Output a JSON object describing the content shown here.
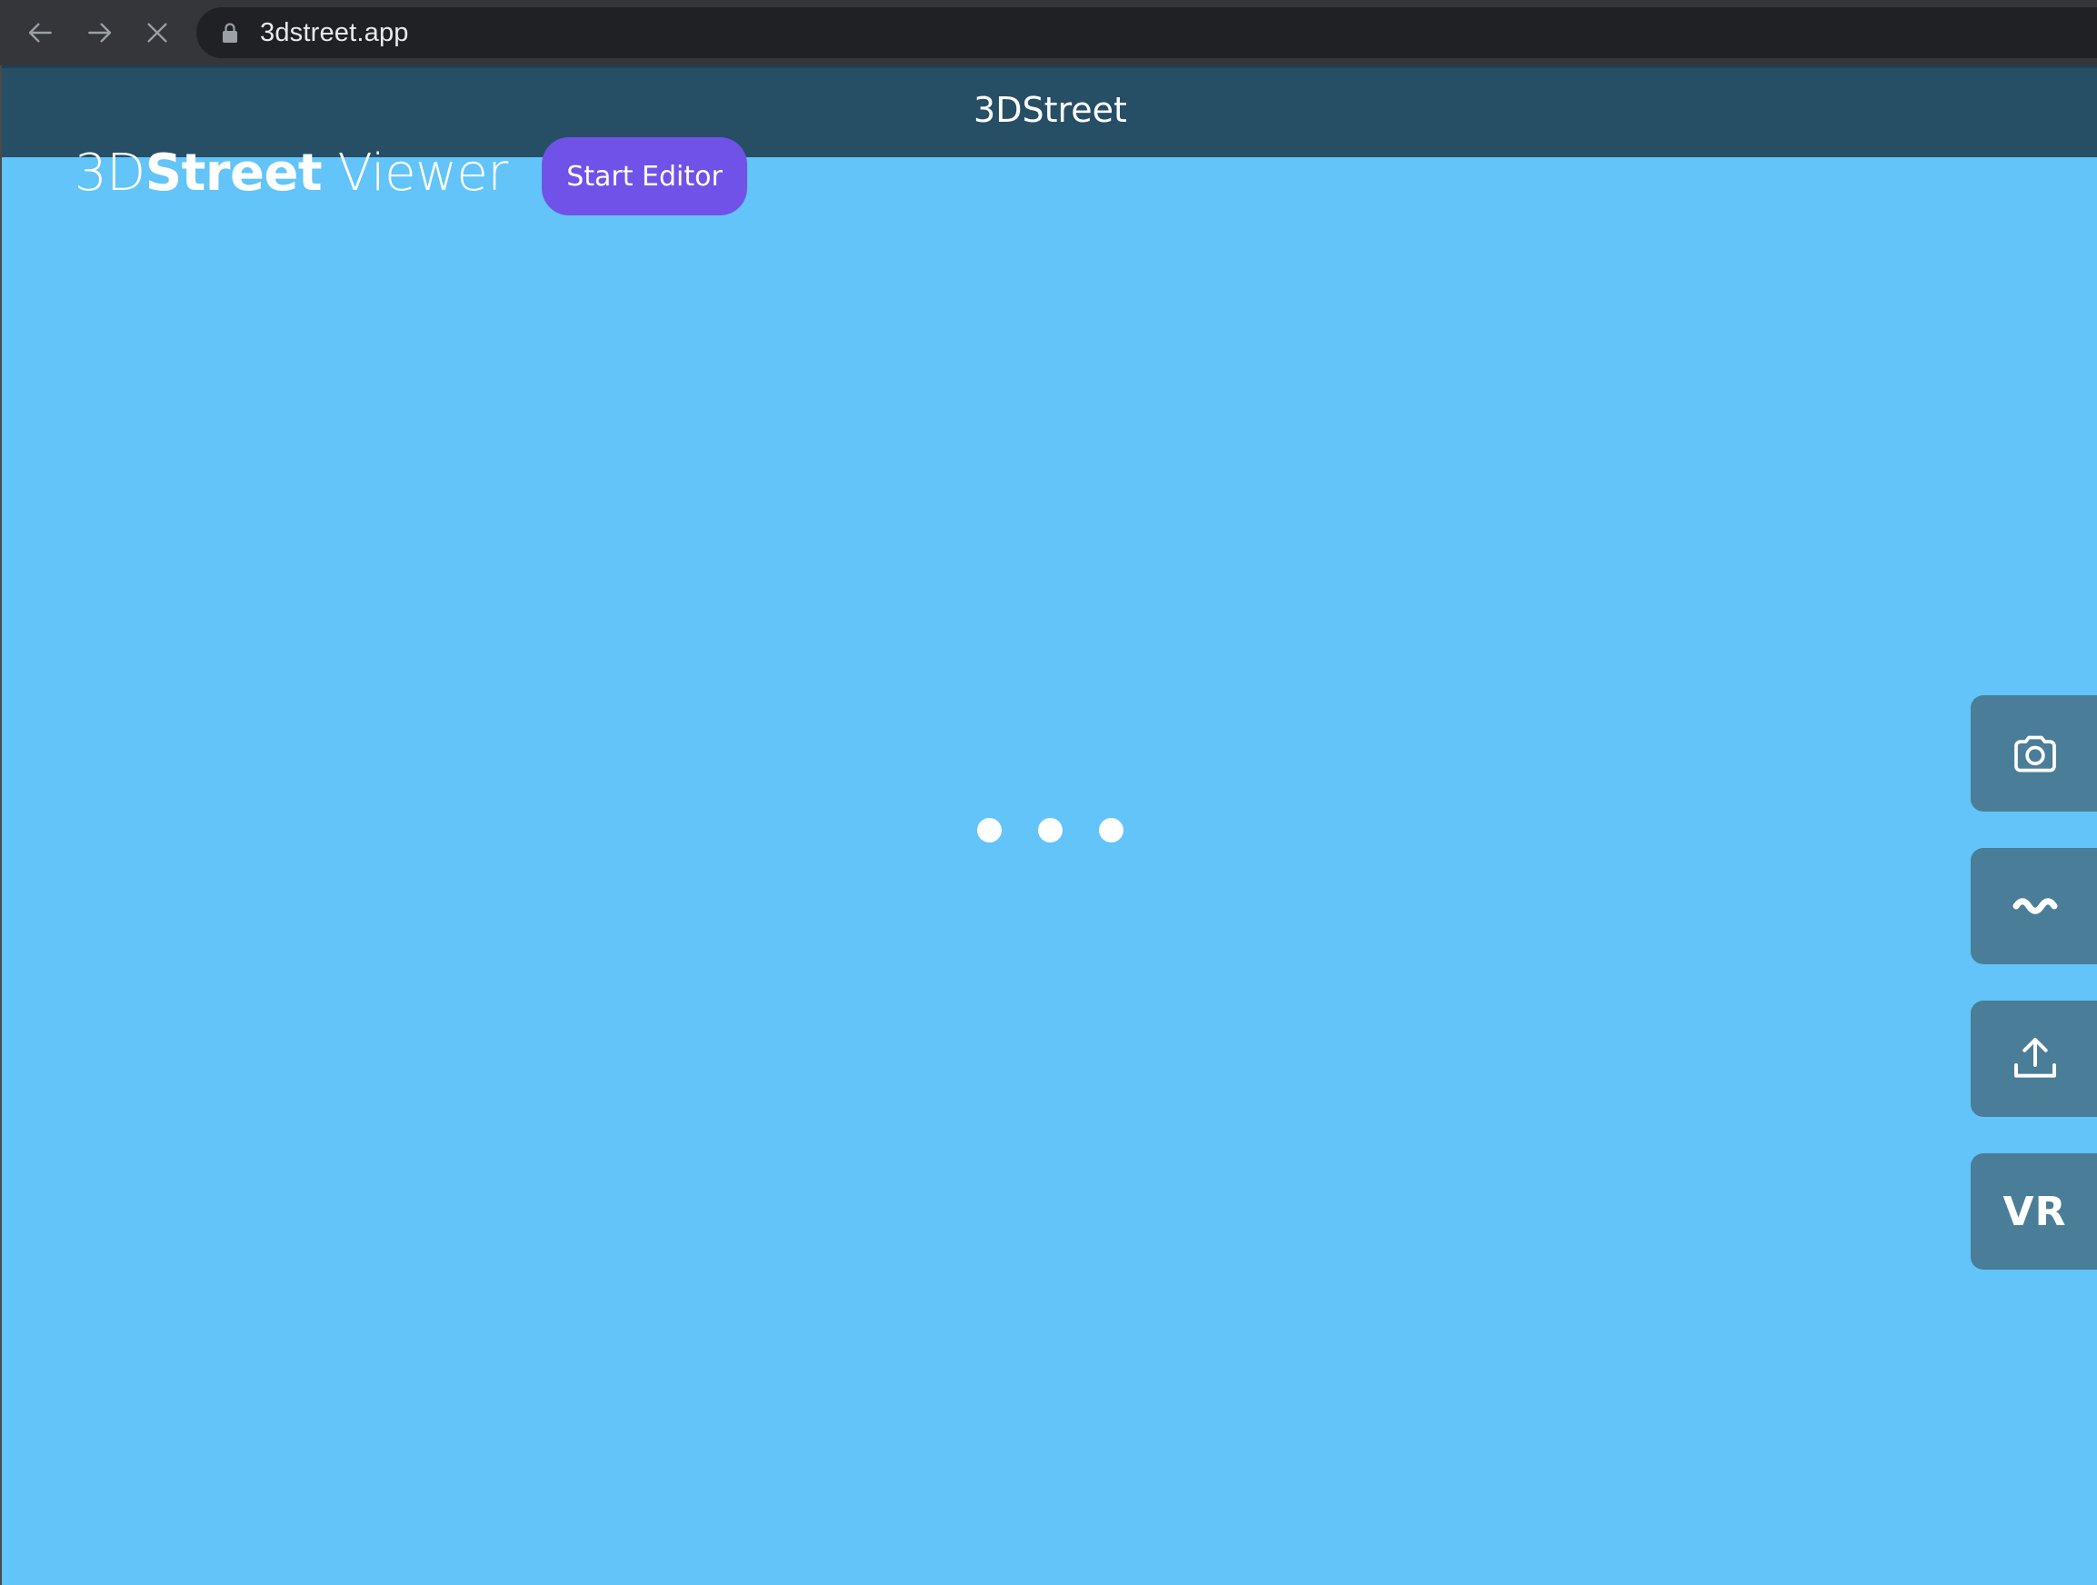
{
  "browser": {
    "url": "3dstreet.app",
    "icons": {
      "back": "arrow-left-icon",
      "forward": "arrow-right-icon",
      "stop": "close-icon",
      "lock": "lock-icon"
    }
  },
  "header": {
    "title": "3DStreet"
  },
  "logo": {
    "prefix": "3D",
    "bold": "Street",
    "suffix": " Viewer"
  },
  "start_editor": {
    "label": "Start Editor"
  },
  "loader": {
    "dots": 3
  },
  "side_buttons": {
    "camera_icon": "camera-icon",
    "wave_icon": "wave-icon",
    "upload_icon": "upload-icon",
    "vr_label": "VR"
  },
  "colors": {
    "background": "#62c4f8",
    "title_bar": "#264f65",
    "accent_button": "#7152e8",
    "side_button": "#4a7d98"
  }
}
